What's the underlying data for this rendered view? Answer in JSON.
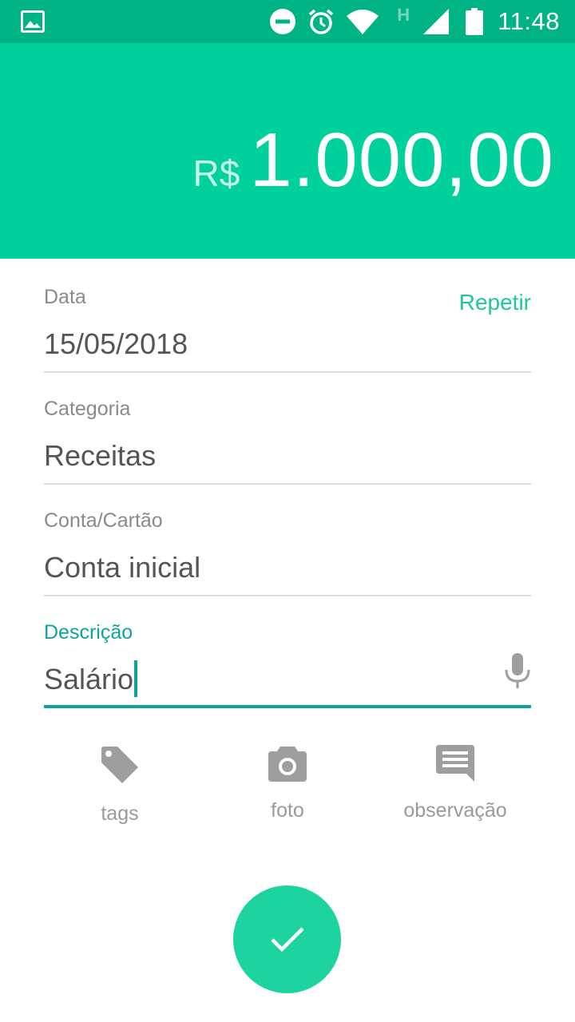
{
  "status_bar": {
    "time": "11:48",
    "network_label": "H",
    "icons": [
      "image-icon",
      "do-not-disturb-icon",
      "alarm-icon",
      "wifi-icon",
      "signal-icon",
      "battery-icon"
    ]
  },
  "header": {
    "currency": "R$",
    "amount": "1.000,00",
    "background_color": "#00D09C"
  },
  "form": {
    "repeat_label": "Repetir",
    "fields": [
      {
        "label": "Data",
        "value": "15/05/2018"
      },
      {
        "label": "Categoria",
        "value": "Receitas"
      },
      {
        "label": "Conta/Cartão",
        "value": "Conta inicial"
      },
      {
        "label": "Descrição",
        "value": "Salário"
      }
    ]
  },
  "actions": [
    {
      "label": "tags",
      "icon": "tag-icon"
    },
    {
      "label": "foto",
      "icon": "camera-icon"
    },
    {
      "label": "observação",
      "icon": "comment-icon"
    }
  ],
  "confirm": {
    "icon": "check-icon",
    "color": "#1DD4A0"
  }
}
